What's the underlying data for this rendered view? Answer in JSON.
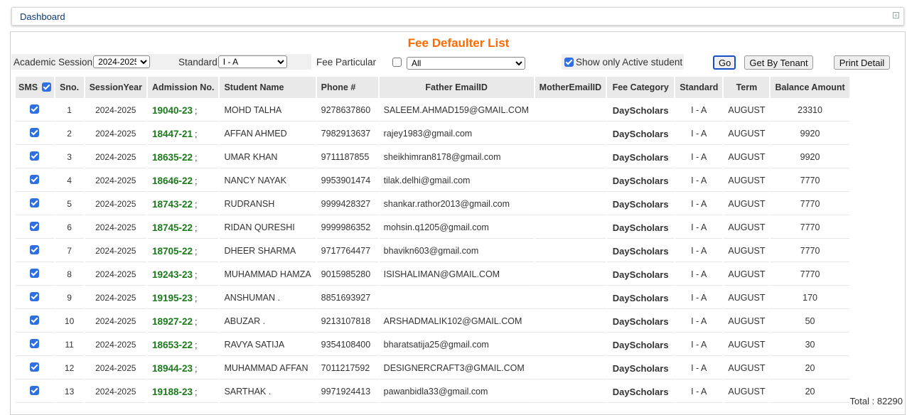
{
  "topbar": {
    "title": "Dashboard"
  },
  "page_title": "Fee Defaulter List",
  "filters": {
    "academic_session_label": "Academic Session",
    "academic_session_value": "2024-2025",
    "standard_label": "Standard",
    "standard_value": "I - A",
    "fee_particular_label": "Fee Particular",
    "fee_particular_value": "All",
    "active_label": "Show only Active student"
  },
  "buttons": {
    "go": "Go",
    "by_tenant": "Get By Tenant",
    "print": "Print Detail"
  },
  "columns": [
    "SMS",
    "Sno.",
    "SessionYear",
    "Admission No.",
    "Student Name",
    "Phone #",
    "Father EmailID",
    "MotherEmailID",
    "Fee Category",
    "Standard",
    "Term",
    "Balance Amount"
  ],
  "rows": [
    {
      "sno": "1",
      "session": "2024-2025",
      "adm": "19040-23",
      "sep": ";",
      "name": "MOHD TALHA",
      "phone": "9278637860",
      "father_email": "SALEEM.AHMAD159@GMAIL.COM",
      "mother_email": "",
      "category": "DayScholars",
      "standard": "I - A",
      "term": "AUGUST",
      "balance": "23310"
    },
    {
      "sno": "2",
      "session": "2024-2025",
      "adm": "18447-21",
      "sep": ";",
      "name": "AFFAN AHMED",
      "phone": "7982913637",
      "father_email": "rajey1983@gmail.com",
      "mother_email": "",
      "category": "DayScholars",
      "standard": "I - A",
      "term": "AUGUST",
      "balance": "9920"
    },
    {
      "sno": "3",
      "session": "2024-2025",
      "adm": "18635-22",
      "sep": ";",
      "name": "UMAR KHAN",
      "phone": "9711187855",
      "father_email": "sheikhimran8178@gmail.com",
      "mother_email": "",
      "category": "DayScholars",
      "standard": "I - A",
      "term": "AUGUST",
      "balance": "9920"
    },
    {
      "sno": "4",
      "session": "2024-2025",
      "adm": "18646-22",
      "sep": ";",
      "name": "NANCY NAYAK",
      "phone": "9953901474",
      "father_email": "tilak.delhi@gmail.com",
      "mother_email": "",
      "category": "DayScholars",
      "standard": "I - A",
      "term": "AUGUST",
      "balance": "7770"
    },
    {
      "sno": "5",
      "session": "2024-2025",
      "adm": "18743-22",
      "sep": ";",
      "name": "RUDRANSH",
      "phone": "9999428327",
      "father_email": "shankar.rathor2013@gmail.com",
      "mother_email": "",
      "category": "DayScholars",
      "standard": "I - A",
      "term": "AUGUST",
      "balance": "7770"
    },
    {
      "sno": "6",
      "session": "2024-2025",
      "adm": "18745-22",
      "sep": ";",
      "name": "RIDAN QURESHI",
      "phone": "9999986352",
      "father_email": "mohsin.q1205@gmail.com",
      "mother_email": "",
      "category": "DayScholars",
      "standard": "I - A",
      "term": "AUGUST",
      "balance": "7770"
    },
    {
      "sno": "7",
      "session": "2024-2025",
      "adm": "18705-22",
      "sep": ";",
      "name": "DHEER SHARMA",
      "phone": "9717764477",
      "father_email": "bhavikn603@gmail.com",
      "mother_email": "",
      "category": "DayScholars",
      "standard": "I - A",
      "term": "AUGUST",
      "balance": "7770"
    },
    {
      "sno": "8",
      "session": "2024-2025",
      "adm": "19243-23",
      "sep": ";",
      "name": "MUHAMMAD HAMZA",
      "phone": "9015985280",
      "father_email": "ISISHALIMAN@GMAIL.COM",
      "mother_email": "",
      "category": "DayScholars",
      "standard": "I - A",
      "term": "AUGUST",
      "balance": "7770"
    },
    {
      "sno": "9",
      "session": "2024-2025",
      "adm": "19195-23",
      "sep": ";",
      "name": "ANSHUMAN .",
      "phone": "8851693927",
      "father_email": "",
      "mother_email": "",
      "category": "DayScholars",
      "standard": "I - A",
      "term": "AUGUST",
      "balance": "170"
    },
    {
      "sno": "10",
      "session": "2024-2025",
      "adm": "18927-22",
      "sep": ";",
      "name": "ABUZAR .",
      "phone": "9213107818",
      "father_email": "ARSHADMALIK102@GMAIL.COM",
      "mother_email": "",
      "category": "DayScholars",
      "standard": "I - A",
      "term": "AUGUST",
      "balance": "50"
    },
    {
      "sno": "11",
      "session": "2024-2025",
      "adm": "18653-22",
      "sep": ";",
      "name": "RAVYA SATIJA",
      "phone": "9354108400",
      "father_email": "bharatsatija25@gmail.com",
      "mother_email": "",
      "category": "DayScholars",
      "standard": "I - A",
      "term": "AUGUST",
      "balance": "30"
    },
    {
      "sno": "12",
      "session": "2024-2025",
      "adm": "18944-23",
      "sep": ";",
      "name": "MUHAMMAD AFFAN",
      "phone": "7011217592",
      "father_email": "DESIGNERCRAFT3@GMAIL.COM",
      "mother_email": "",
      "category": "DayScholars",
      "standard": "I - A",
      "term": "AUGUST",
      "balance": "20"
    },
    {
      "sno": "13",
      "session": "2024-2025",
      "adm": "19188-23",
      "sep": ";",
      "name": "SARTHAK .",
      "phone": "9971924413",
      "father_email": "pawanbidla33@gmail.com",
      "mother_email": "",
      "category": "DayScholars",
      "standard": "I - A",
      "term": "AUGUST",
      "balance": "20"
    }
  ],
  "total_label": "Total : 82290"
}
